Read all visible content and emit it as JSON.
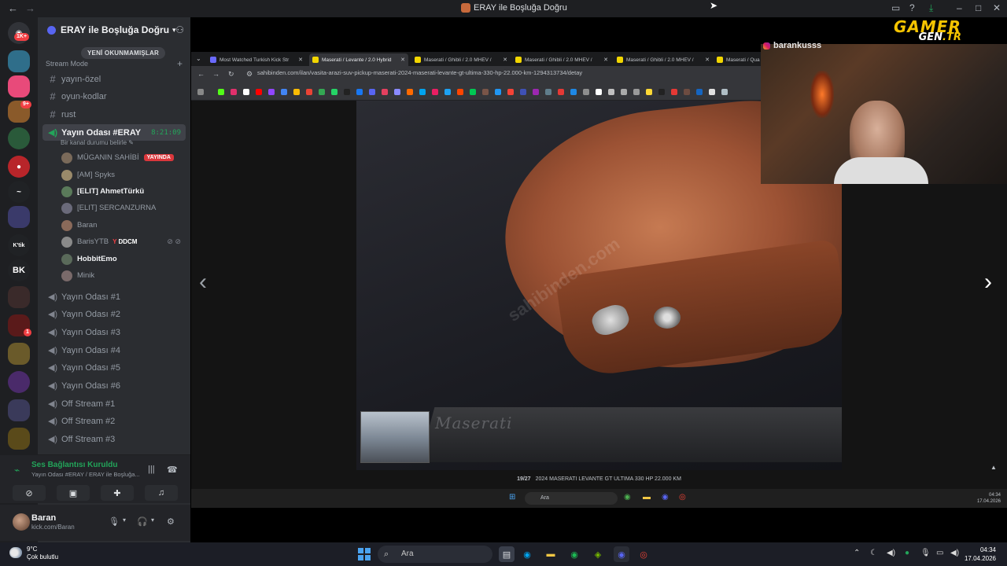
{
  "window": {
    "title": "ERAY ile Boşluğa Doğru"
  },
  "server": {
    "name": "ERAY ile Boşluğa Doğru",
    "unread_pill": "YENİ OKUNMAMIŞLAR",
    "category": "Stream Mode",
    "rail_badges": [
      "1K+",
      "9+",
      "1"
    ]
  },
  "channels": [
    {
      "type": "text",
      "name": "yayın-özel"
    },
    {
      "type": "text",
      "name": "oyun-kodlar"
    },
    {
      "type": "text",
      "name": "rust"
    }
  ],
  "active_voice": {
    "name": "Yayın Odası #ERAY",
    "timer": "8:21:09",
    "status": "Bir kanal durumu belirle"
  },
  "voice_users": [
    {
      "name": "MÜGANIN SAHİBİ",
      "live": "YAYINDA",
      "bold": false,
      "color": "#7a6a5a"
    },
    {
      "name": "[AM] Spyks",
      "bold": false,
      "color": "#9a8a6a"
    },
    {
      "name": "[ELIT] AhmetTürkü",
      "bold": true,
      "color": "#5a7a5a"
    },
    {
      "name": "[ELIT] SERCANZURNA",
      "bold": false,
      "color": "#6a6a7a"
    },
    {
      "name": "Baran",
      "bold": false,
      "color": "#8a6a5a"
    },
    {
      "name": "BarisYTB",
      "tag": "DDCM",
      "bold": false,
      "color": "#8a8a8a"
    },
    {
      "name": "HobbitEmo",
      "bold": true,
      "color": "#5a6a5a"
    },
    {
      "name": "Minik",
      "bold": false,
      "color": "#7a6a6a"
    }
  ],
  "voice_channels": [
    "Yayın Odası #1",
    "Yayın Odası #2",
    "Yayın Odası #3",
    "Yayın Odası #4",
    "Yayın Odası #5",
    "Yayın Odası #6",
    "Off Stream #1",
    "Off Stream #2",
    "Off Stream #3"
  ],
  "voice_panel": {
    "title": "Ses Bağlantısı Kuruldu",
    "subtitle": "Yayın Odası #ERAY / ERAY ile Boşluğa..."
  },
  "user": {
    "name": "Baran",
    "status": "kick.com/Baran"
  },
  "stream": {
    "cam_name": "barankusss",
    "logo_line1": "GAMER",
    "logo_line2a": "GEN",
    "logo_line2b": ".TR",
    "browser": {
      "tabs": [
        {
          "title": "Most Watched Turkish Kick Str",
          "color": "#6a6aff",
          "active": false
        },
        {
          "title": "Maserati / Levante / 2.0 Hybrid",
          "color": "#f2d600",
          "active": true
        },
        {
          "title": "Maserati / Ghibli / 2.0 MHEV / ",
          "color": "#f2d600",
          "active": false
        },
        {
          "title": "Maserati / Ghibli / 2.0 MHEV / ",
          "color": "#f2d600",
          "active": false
        },
        {
          "title": "Maserati / Ghibli / 2.0 MHEV / ",
          "color": "#f2d600",
          "active": false
        },
        {
          "title": "Maserati / Qua",
          "color": "#f2d600",
          "active": false
        }
      ],
      "url": "sahibinden.com/ilan/vasita-arazi-suv-pickup-maserati-2024-maserati-levante-gt-ultima-330-hp-22.000-km-1294313734/detay",
      "listing_id": "#1294313734",
      "watermark": "sahibinden.com",
      "sill_text": "Maserati",
      "caption_index": "19/27",
      "caption_text": "2024 MASERATI LEVANTE GT ULTIMA 330 HP 22.000 KM",
      "inner_search": "Ara",
      "inner_time": "04:34",
      "inner_date": "17.04.2026"
    }
  },
  "taskbar": {
    "temp": "9°C",
    "weather": "Çok bulutlu",
    "search": "Ara",
    "time": "04:34",
    "date": "17.04.2026"
  }
}
